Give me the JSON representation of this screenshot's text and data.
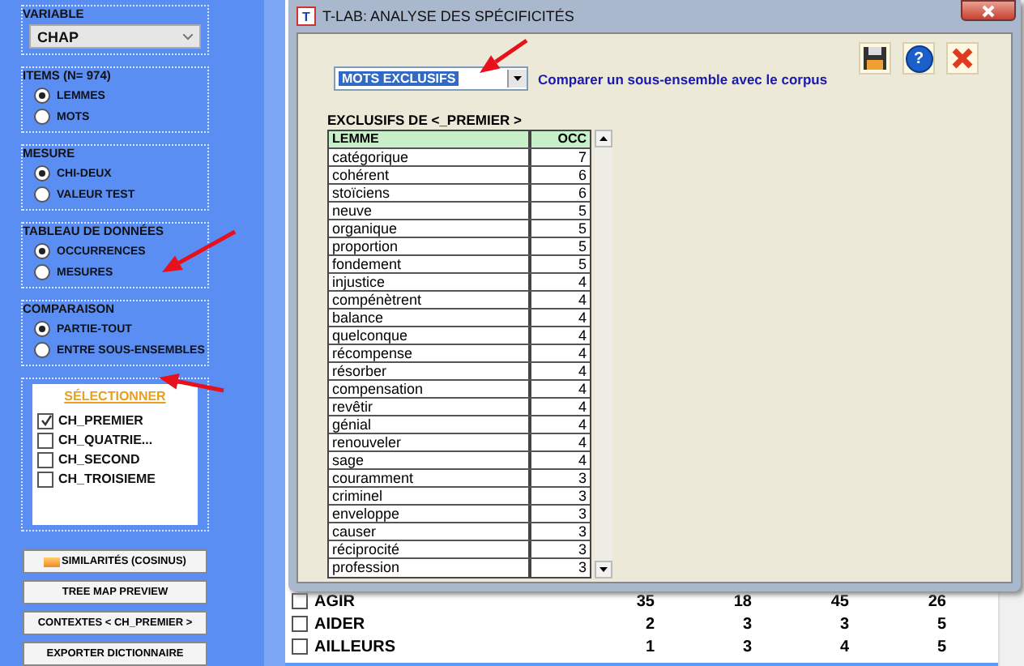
{
  "sidebar": {
    "variable": {
      "label": "VARIABLE",
      "value": "CHAP"
    },
    "groups": [
      {
        "title": "ITEMS (N= 974)",
        "options": [
          {
            "label": "LEMMES",
            "selected": true
          },
          {
            "label": "MOTS",
            "selected": false
          }
        ]
      },
      {
        "title": "MESURE",
        "options": [
          {
            "label": "CHI-DEUX",
            "selected": true
          },
          {
            "label": "VALEUR TEST",
            "selected": false
          }
        ]
      },
      {
        "title": "TABLEAU DE DONNÉES",
        "options": [
          {
            "label": "OCCURRENCES",
            "selected": true
          },
          {
            "label": "MESURES",
            "selected": false
          }
        ]
      },
      {
        "title": "COMPARAISON",
        "options": [
          {
            "label": "PARTIE-TOUT",
            "selected": true
          },
          {
            "label": "ENTRE SOUS-ENSEMBLES",
            "selected": false
          }
        ]
      }
    ],
    "selection": {
      "title": "SÉLECTIONNER",
      "items": [
        {
          "label": "CH_PREMIER",
          "checked": true
        },
        {
          "label": "CH_QUATRIE...",
          "checked": false
        },
        {
          "label": "CH_SECOND",
          "checked": false
        },
        {
          "label": "CH_TROISIEME",
          "checked": false
        }
      ]
    },
    "buttons": [
      {
        "label": "SIMILARITÉS (COSINUS)",
        "kind": "new"
      },
      {
        "label": "TREE MAP PREVIEW",
        "kind": "plain"
      },
      {
        "label": "CONTEXTES  < CH_PREMIER >",
        "kind": "plain"
      },
      {
        "label": "EXPORTER DICTIONNAIRE",
        "kind": "plain"
      }
    ]
  },
  "background_table": {
    "rows": [
      {
        "label": "AGIR",
        "checked": false,
        "values": [
          "35",
          "18",
          "45",
          "26"
        ]
      },
      {
        "label": "AIDER",
        "checked": false,
        "values": [
          "2",
          "3",
          "3",
          "5"
        ]
      },
      {
        "label": "AILLEURS",
        "checked": false,
        "values": [
          "1",
          "3",
          "4",
          "5"
        ]
      }
    ]
  },
  "dialog": {
    "title": "T-LAB: ANALYSE DES SPÉCIFICITÉS",
    "app_icon": "T",
    "toolbar": [
      {
        "kind": "save"
      },
      {
        "kind": "help",
        "symbol": "?"
      },
      {
        "kind": "close"
      }
    ],
    "mode": "MOTS EXCLUSIFS",
    "description": "Comparer un sous-ensemble avec le corpus",
    "table_title": "EXCLUSIFS DE <_PREMIER >",
    "columns": [
      "LEMME",
      "OCC"
    ],
    "rows": [
      [
        "catégorique",
        "7"
      ],
      [
        "cohérent",
        "6"
      ],
      [
        "stoïciens",
        "6"
      ],
      [
        "neuve",
        "5"
      ],
      [
        "organique",
        "5"
      ],
      [
        "proportion",
        "5"
      ],
      [
        "fondement",
        "5"
      ],
      [
        "injustice",
        "4"
      ],
      [
        "compénètrent",
        "4"
      ],
      [
        "balance",
        "4"
      ],
      [
        "quelconque",
        "4"
      ],
      [
        "récompense",
        "4"
      ],
      [
        "résorber",
        "4"
      ],
      [
        "compensation",
        "4"
      ],
      [
        "revêtir",
        "4"
      ],
      [
        "génial",
        "4"
      ],
      [
        "renouveler",
        "4"
      ],
      [
        "sage",
        "4"
      ],
      [
        "couramment",
        "3"
      ],
      [
        "criminel",
        "3"
      ],
      [
        "enveloppe",
        "3"
      ],
      [
        "causer",
        "3"
      ],
      [
        "réciprocité",
        "3"
      ],
      [
        "profession",
        "3"
      ]
    ]
  }
}
